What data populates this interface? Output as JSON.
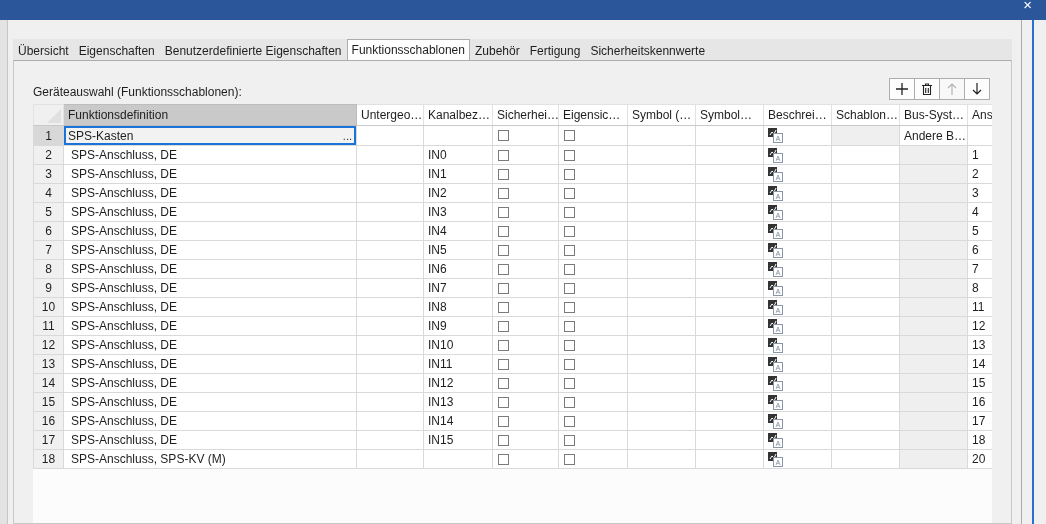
{
  "window": {
    "close": "×"
  },
  "tabs": [
    {
      "label": "Übersicht",
      "selected": false
    },
    {
      "label": "Eigenschaften",
      "selected": false
    },
    {
      "label": "Benutzerdefinierte Eigenschaften",
      "selected": false
    },
    {
      "label": "Funktionsschablonen",
      "selected": true
    },
    {
      "label": "Zubehör",
      "selected": false
    },
    {
      "label": "Fertigung",
      "selected": false
    },
    {
      "label": "Sicherheitskennwerte",
      "selected": false
    }
  ],
  "section_label": "Geräteauswahl (Funktionsschablonen):",
  "toolbar": [
    {
      "kind": "add",
      "disabled": false
    },
    {
      "kind": "delete",
      "disabled": false
    },
    {
      "kind": "up",
      "disabled": true
    },
    {
      "kind": "down",
      "disabled": false
    }
  ],
  "table": {
    "columns": [
      "Funktionsdefinition",
      "Untergeo…",
      "Kanalbez…",
      "Sicherhei…",
      "Eigensic…",
      "Symbol (…",
      "Symbol…",
      "Beschrei…",
      "Schablon…",
      "Bus-Syst…",
      "Ans"
    ],
    "rows": [
      {
        "num": "1",
        "kind": "device",
        "selected": true,
        "function": "SPS-Kasten",
        "browse": "...",
        "channel": "",
        "safety": false,
        "own": false,
        "bus": "Andere B…",
        "ans": ""
      },
      {
        "num": "2",
        "kind": "connection",
        "selected": false,
        "function": "SPS-Anschluss, DE",
        "channel": "IN0",
        "safety": false,
        "own": false,
        "ans": "1"
      },
      {
        "num": "3",
        "kind": "connection",
        "selected": false,
        "function": "SPS-Anschluss, DE",
        "channel": "IN1",
        "safety": false,
        "own": false,
        "ans": "2"
      },
      {
        "num": "4",
        "kind": "connection",
        "selected": false,
        "function": "SPS-Anschluss, DE",
        "channel": "IN2",
        "safety": false,
        "own": false,
        "ans": "3"
      },
      {
        "num": "5",
        "kind": "connection",
        "selected": false,
        "function": "SPS-Anschluss, DE",
        "channel": "IN3",
        "safety": false,
        "own": false,
        "ans": "4"
      },
      {
        "num": "6",
        "kind": "connection",
        "selected": false,
        "function": "SPS-Anschluss, DE",
        "channel": "IN4",
        "safety": false,
        "own": false,
        "ans": "5"
      },
      {
        "num": "7",
        "kind": "connection",
        "selected": false,
        "function": "SPS-Anschluss, DE",
        "channel": "IN5",
        "safety": false,
        "own": false,
        "ans": "6"
      },
      {
        "num": "8",
        "kind": "connection",
        "selected": false,
        "function": "SPS-Anschluss, DE",
        "channel": "IN6",
        "safety": false,
        "own": false,
        "ans": "7"
      },
      {
        "num": "9",
        "kind": "connection",
        "selected": false,
        "function": "SPS-Anschluss, DE",
        "channel": "IN7",
        "safety": false,
        "own": false,
        "ans": "8"
      },
      {
        "num": "10",
        "kind": "connection",
        "selected": false,
        "function": "SPS-Anschluss, DE",
        "channel": "IN8",
        "safety": false,
        "own": false,
        "ans": "11"
      },
      {
        "num": "11",
        "kind": "connection",
        "selected": false,
        "function": "SPS-Anschluss, DE",
        "channel": "IN9",
        "safety": false,
        "own": false,
        "ans": "12"
      },
      {
        "num": "12",
        "kind": "connection",
        "selected": false,
        "function": "SPS-Anschluss, DE",
        "channel": "IN10",
        "safety": false,
        "own": false,
        "ans": "13"
      },
      {
        "num": "13",
        "kind": "connection",
        "selected": false,
        "function": "SPS-Anschluss, DE",
        "channel": "IN11",
        "safety": false,
        "own": false,
        "ans": "14"
      },
      {
        "num": "14",
        "kind": "connection",
        "selected": false,
        "function": "SPS-Anschluss, DE",
        "channel": "IN12",
        "safety": false,
        "own": false,
        "ans": "15"
      },
      {
        "num": "15",
        "kind": "connection",
        "selected": false,
        "function": "SPS-Anschluss, DE",
        "channel": "IN13",
        "safety": false,
        "own": false,
        "ans": "16"
      },
      {
        "num": "16",
        "kind": "connection",
        "selected": false,
        "function": "SPS-Anschluss, DE",
        "channel": "IN14",
        "safety": false,
        "own": false,
        "ans": "17"
      },
      {
        "num": "17",
        "kind": "connection",
        "selected": false,
        "function": "SPS-Anschluss, DE",
        "channel": "IN15",
        "safety": false,
        "own": false,
        "ans": "18"
      },
      {
        "num": "18",
        "kind": "connection",
        "selected": false,
        "function": "SPS-Anschluss, SPS-KV (M)",
        "channel": "",
        "safety": false,
        "own": false,
        "ans": "20"
      }
    ]
  }
}
